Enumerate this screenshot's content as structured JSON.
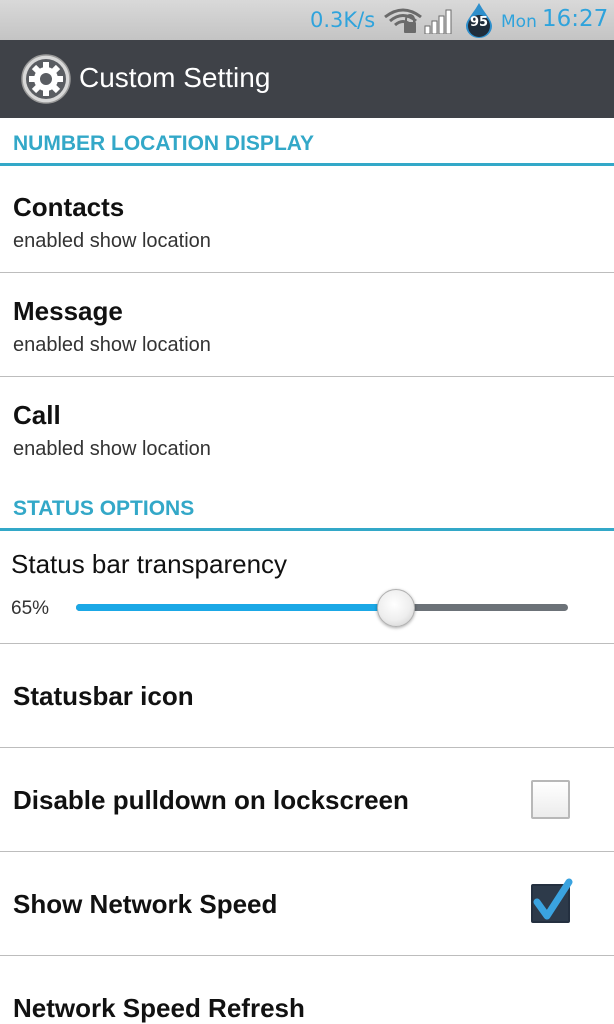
{
  "status_bar": {
    "net_speed": "0.3K/s",
    "battery_level": "95",
    "day": "Mon",
    "time": "16:27",
    "accent_color": "#2fa3dc"
  },
  "action_bar": {
    "title": "Custom Setting",
    "icon": "gear-icon",
    "background": "#3f4248"
  },
  "sections": [
    {
      "header": "NUMBER LOCATION DISPLAY",
      "items": [
        {
          "title": "Contacts",
          "summary": "enabled show location"
        },
        {
          "title": "Message",
          "summary": "enabled show location"
        },
        {
          "title": "Call",
          "summary": "enabled show location"
        }
      ]
    },
    {
      "header": "STATUS OPTIONS",
      "slider": {
        "label": "Status bar transparency",
        "value_text": "65%",
        "value": 0.65
      },
      "items": [
        {
          "title": "Statusbar icon"
        },
        {
          "title": "Disable pulldown on lockscreen",
          "checked": false
        },
        {
          "title": "Show Network Speed",
          "checked": true
        },
        {
          "title": "Network Speed Refresh"
        }
      ]
    }
  ],
  "colors": {
    "section_header": "#33a8c8",
    "slider_fill": "#1ba8e6"
  }
}
